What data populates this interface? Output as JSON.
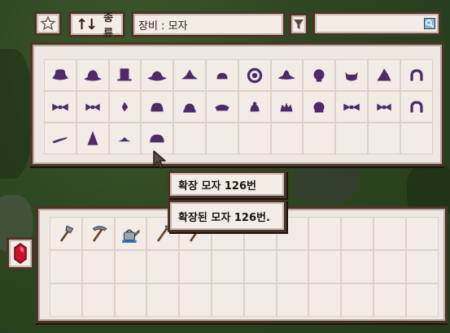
{
  "toolbar": {
    "sort_label": "종류",
    "filter_value": "장비 : 모자",
    "search_value": ""
  },
  "tooltips": {
    "title": "확장 모자 126번",
    "description": "확장된 모자 126번."
  },
  "hat_items": [
    "hat-cowboy",
    "hat-bowler",
    "hat-tophat",
    "hat-wide",
    "hat-witch-flat",
    "hat-cap-small",
    "hat-diving",
    "hat-straw",
    "hat-helmet-round",
    "hat-cat-ears",
    "hat-wizard-short",
    "hat-headphones",
    "hat-bow-1",
    "hat-bow-2",
    "hat-feather",
    "hat-beanie",
    "hat-knit",
    "hat-cap-brim",
    "hat-bun",
    "hat-crown-small",
    "hat-turban",
    "hat-bow-3",
    "hat-bow-4",
    "hat-hood",
    "hat-pipe",
    "hat-pointed",
    "hat-flat-sm",
    "hat-extended-126"
  ],
  "tool_items": [
    "axe-icon",
    "pickaxe-icon",
    "watering-can-icon",
    "hoe-icon",
    "scythe-icon"
  ],
  "colors": {
    "panel": "#efe7e1",
    "border": "#4a3428",
    "item_purple": "#4e2a6b",
    "ruby": "#c9132a"
  }
}
